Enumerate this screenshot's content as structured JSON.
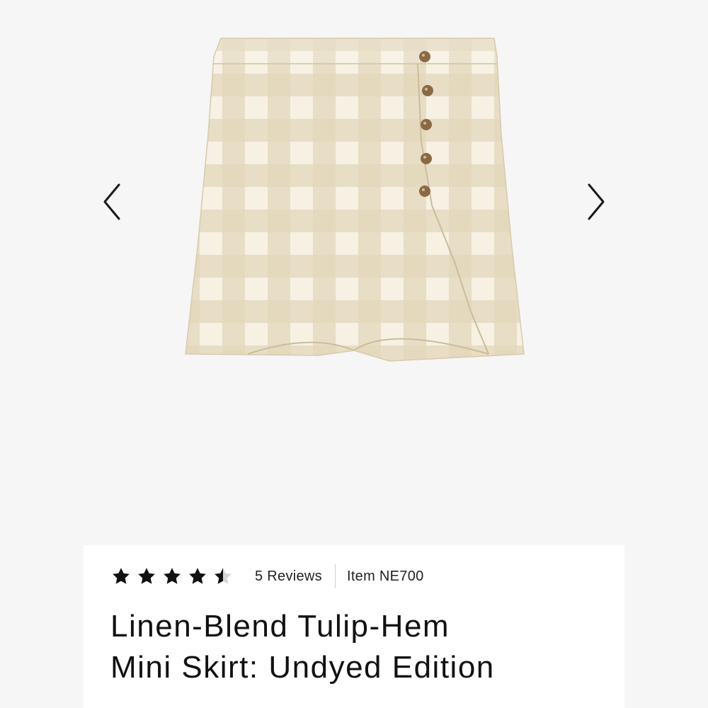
{
  "gallery": {
    "prev_icon": "chevron-left-icon",
    "next_icon": "chevron-right-icon",
    "image_alt": "Linen-Blend Tulip-Hem Mini Skirt: Undyed Edition",
    "colors": {
      "check_light": "#f5f0e1",
      "check_dark": "#dccfb0",
      "button": "#8a6a45"
    }
  },
  "product": {
    "rating": 4.5,
    "rating_max": 5,
    "reviews_label": "5 Reviews",
    "item_label": "Item NE700",
    "title_line1": "Linen-Blend Tulip-Hem",
    "title_line2": "Mini Skirt: Undyed Edition"
  }
}
